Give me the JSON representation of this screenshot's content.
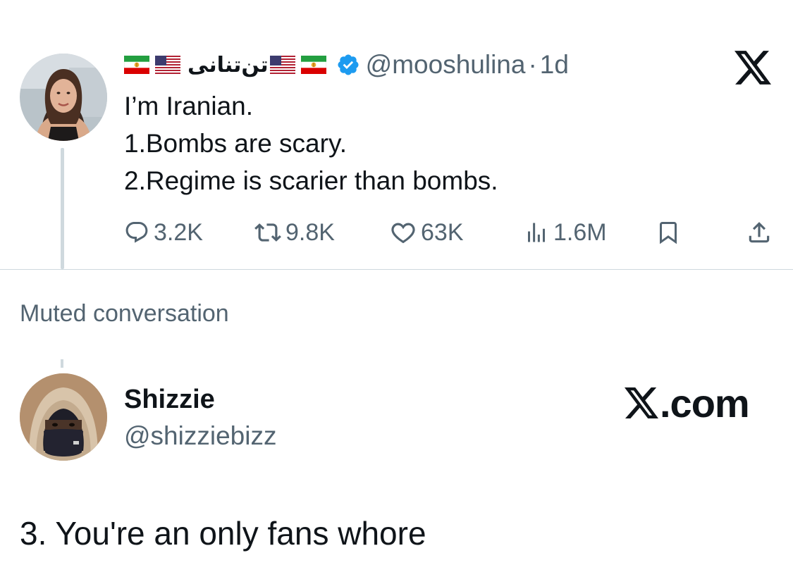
{
  "tweet": {
    "display_name": "تن‌تنانی",
    "handle": "@mooshulina",
    "separator": "·",
    "time": "1d",
    "lines": [
      "I’m Iranian.",
      "1.Bombs are scary.",
      "2.Regime is scarier than bombs."
    ],
    "stats": {
      "replies": "3.2K",
      "reposts": "9.8K",
      "likes": "63K",
      "views": "1.6M"
    }
  },
  "muted_label": "Muted conversation",
  "reply": {
    "display_name": "Shizzie",
    "handle": "@shizziebizz",
    "text": "3. You're an only fans whore"
  },
  "watermark": {
    "text": ".com"
  },
  "icons": [
    "iran-flag-icon",
    "us-flag-icon",
    "verified-badge-icon",
    "x-logo-icon",
    "reply-icon",
    "repost-icon",
    "like-icon",
    "views-icon",
    "bookmark-icon",
    "share-icon"
  ],
  "colors": {
    "text": "#0f1419",
    "secondary": "#536471",
    "verified": "#1d9bf0",
    "divider": "#cfd9de"
  }
}
